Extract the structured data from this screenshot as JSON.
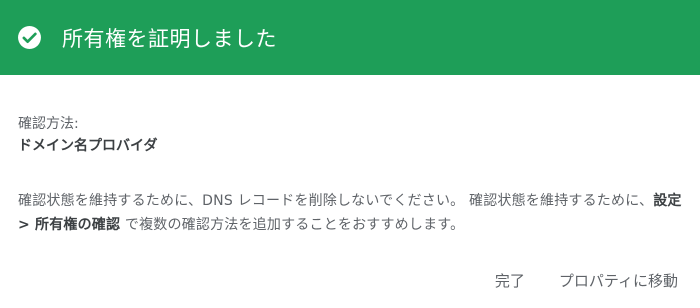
{
  "header": {
    "title": "所有権を証明しました",
    "icon": "check-circle-icon",
    "background_color": "#1e9e58"
  },
  "method": {
    "label": "確認方法:",
    "value": "ドメイン名プロバイダ"
  },
  "note": {
    "part1": "確認状態を維持するために、DNS レコードを削除しないでください。 確認状態を維持するために、",
    "bold": "設定 > 所有権の確認",
    "part2": " で複数の確認方法を追加することをおすすめします。"
  },
  "actions": {
    "done_label": "完了",
    "go_to_property_label": "プロパティに移動"
  }
}
